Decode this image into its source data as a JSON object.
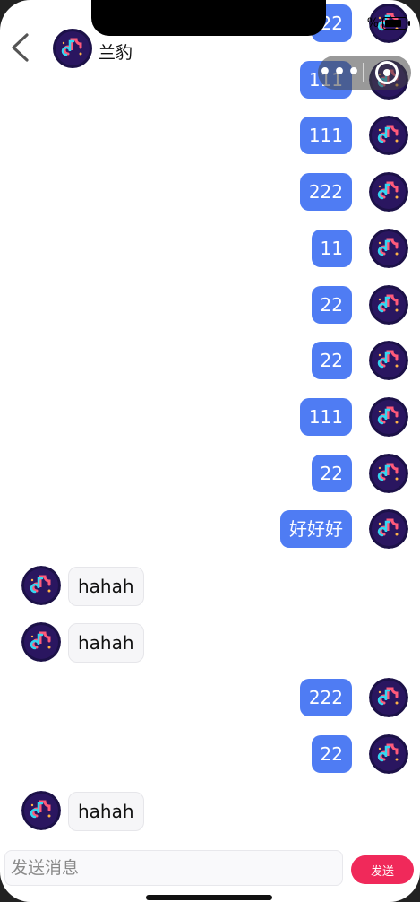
{
  "header": {
    "name": "兰豹"
  },
  "status": {
    "battery_text": "%"
  },
  "capsule": {
    "more": "•••"
  },
  "messages": [
    {
      "dir": "out",
      "text": "22"
    },
    {
      "dir": "out",
      "text": "111"
    },
    {
      "dir": "out",
      "text": "111"
    },
    {
      "dir": "out",
      "text": "222"
    },
    {
      "dir": "out",
      "text": "11"
    },
    {
      "dir": "out",
      "text": "22"
    },
    {
      "dir": "out",
      "text": "22"
    },
    {
      "dir": "out",
      "text": "111"
    },
    {
      "dir": "out",
      "text": "22"
    },
    {
      "dir": "out",
      "text": "好好好"
    },
    {
      "dir": "in",
      "text": "hahah"
    },
    {
      "dir": "in",
      "text": "hahah"
    },
    {
      "dir": "out",
      "text": "222"
    },
    {
      "dir": "out",
      "text": "22"
    },
    {
      "dir": "in",
      "text": "hahah"
    }
  ],
  "input": {
    "placeholder": "发送消息",
    "send_label": "发送"
  }
}
